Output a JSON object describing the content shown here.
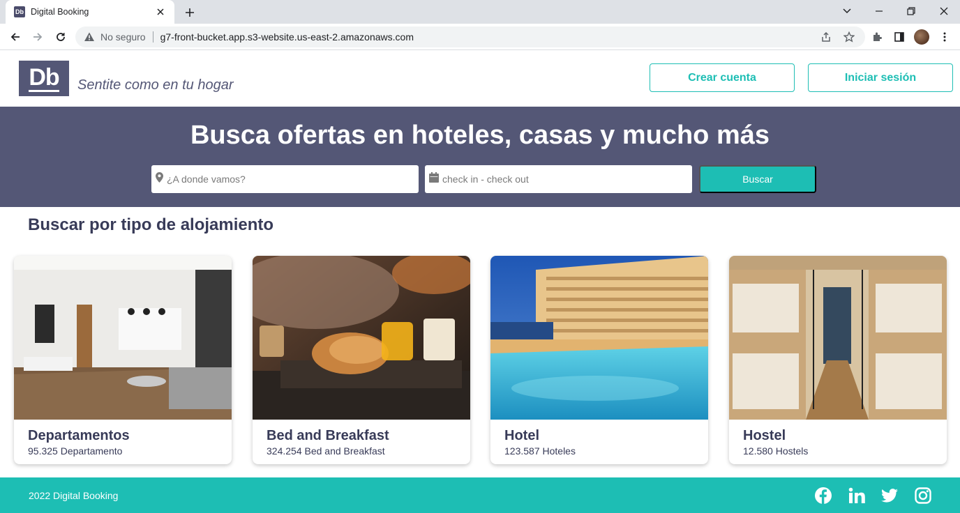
{
  "browser": {
    "tab_title": "Digital Booking",
    "favicon_text": "Db",
    "security_label": "No seguro",
    "url": "g7-front-bucket.app.s3-website.us-east-2.amazonaws.com"
  },
  "header": {
    "logo_text": "Db",
    "slogan": "Sentite como en tu hogar",
    "create_account": "Crear cuenta",
    "login": "Iniciar sesión"
  },
  "hero": {
    "title": "Busca ofertas en hoteles, casas y mucho más",
    "destination_placeholder": "¿A donde vamos?",
    "dates_placeholder": "check in - check out",
    "search_button": "Buscar"
  },
  "categories": {
    "title": "Buscar por tipo de alojamiento",
    "items": [
      {
        "name": "Departamentos",
        "count": "95.325 Departamento",
        "image": "apartment-interior"
      },
      {
        "name": "Bed and Breakfast",
        "count": "324.254 Bed and Breakfast",
        "image": "breakfast-tray"
      },
      {
        "name": "Hotel",
        "count": "123.587 Hoteles",
        "image": "hotel-pool"
      },
      {
        "name": "Hostel",
        "count": "12.580 Hostels",
        "image": "hostel-bunks"
      }
    ]
  },
  "footer": {
    "copyright": "2022 Digital Booking",
    "social": [
      "facebook-icon",
      "linkedin-icon",
      "twitter-icon",
      "instagram-icon"
    ]
  },
  "colors": {
    "primary": "#1dbeb4",
    "secondary": "#545776",
    "text_dark": "#383b58"
  }
}
